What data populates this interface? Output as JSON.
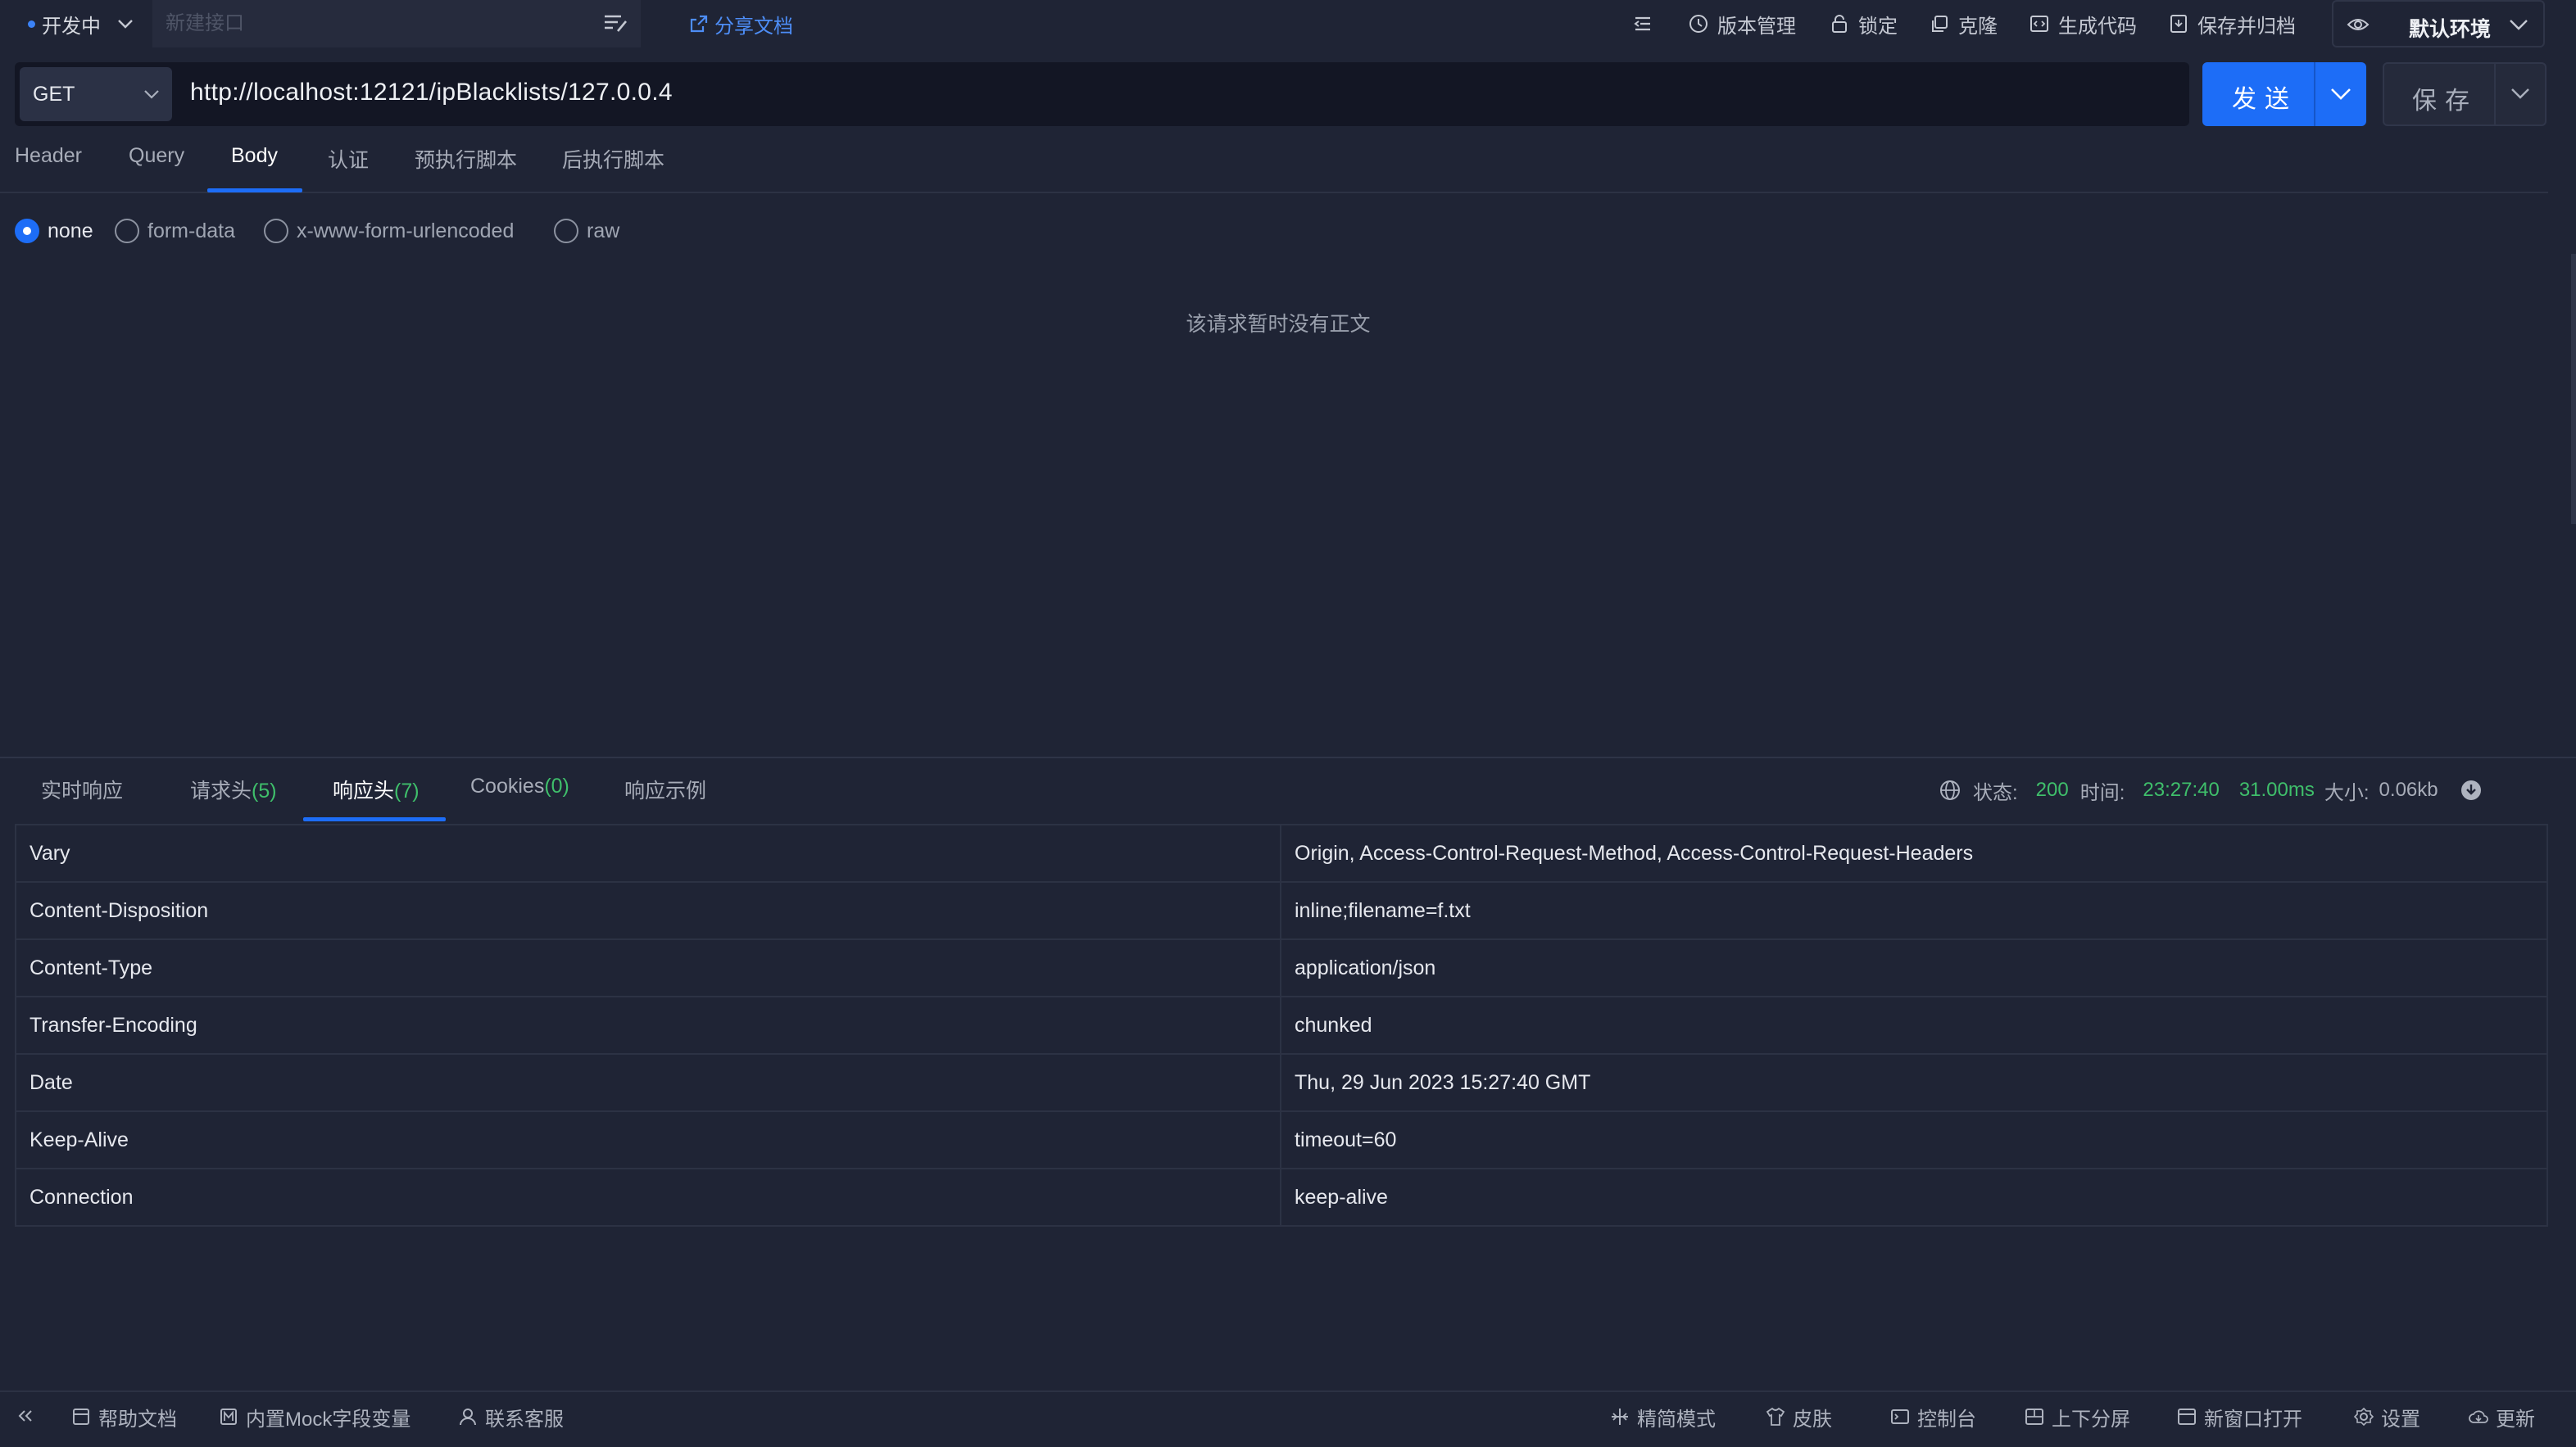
{
  "topbar": {
    "env_status": "开发中",
    "name_placeholder": "新建接口",
    "share_label": "分享文档",
    "tools": {
      "version": "版本管理",
      "lock": "锁定",
      "clone": "克隆",
      "gencode": "生成代码",
      "archive": "保存并归档"
    },
    "environment": "默认环境"
  },
  "request": {
    "method": "GET",
    "url": "http://localhost:12121/ipBlacklists/127.0.0.4",
    "send_label": "发送",
    "save_label": "保存",
    "tabs": [
      "Header",
      "Query",
      "Body",
      "认证",
      "预执行脚本",
      "后执行脚本"
    ],
    "active_tab": "Body",
    "body_types": [
      "none",
      "form-data",
      "x-www-form-urlencoded",
      "raw"
    ],
    "selected_body_type": "none",
    "empty_message": "该请求暂时没有正文"
  },
  "response": {
    "tabs": {
      "realtime": "实时响应",
      "req_headers": "请求头",
      "req_headers_count": "(5)",
      "res_headers": "响应头",
      "res_headers_count": "(7)",
      "cookies": "Cookies",
      "cookies_count": "(0)",
      "examples": "响应示例"
    },
    "active_tab": "响应头",
    "status_label": "状态:",
    "status_code": "200",
    "time_label": "时间:",
    "time_value": "23:27:40",
    "duration": "31.00ms",
    "size_label": "大小:",
    "size_value": "0.06kb",
    "headers": [
      {
        "key": "Vary",
        "value": "Origin, Access-Control-Request-Method, Access-Control-Request-Headers"
      },
      {
        "key": "Content-Disposition",
        "value": "inline;filename=f.txt"
      },
      {
        "key": "Content-Type",
        "value": "application/json"
      },
      {
        "key": "Transfer-Encoding",
        "value": "chunked"
      },
      {
        "key": "Date",
        "value": "Thu, 29 Jun 2023 15:27:40 GMT"
      },
      {
        "key": "Keep-Alive",
        "value": "timeout=60"
      },
      {
        "key": "Connection",
        "value": "keep-alive"
      }
    ]
  },
  "bottombar": {
    "help": "帮助文档",
    "mock": "内置Mock字段变量",
    "support": "联系客服",
    "simple": "精简模式",
    "skin": "皮肤",
    "console": "控制台",
    "split": "上下分屏",
    "newwin": "新窗口打开",
    "settings": "设置",
    "update": "更新"
  },
  "colors": {
    "background": "#1f2435",
    "accent": "#1d6df7",
    "success": "#3fbf6b",
    "link": "#4d8df6"
  },
  "icons": [
    "chevron-down-icon",
    "format-icon",
    "share-icon",
    "indent-icon",
    "history-icon",
    "lock-icon",
    "copy-icon",
    "code-icon",
    "archive-icon",
    "eye-icon",
    "globe-icon",
    "download-icon",
    "collapse-icon",
    "doc-icon",
    "mock-icon",
    "user-icon",
    "compress-icon",
    "shirt-icon",
    "terminal-icon",
    "split-icon",
    "window-icon",
    "gear-icon",
    "cloud-icon"
  ]
}
